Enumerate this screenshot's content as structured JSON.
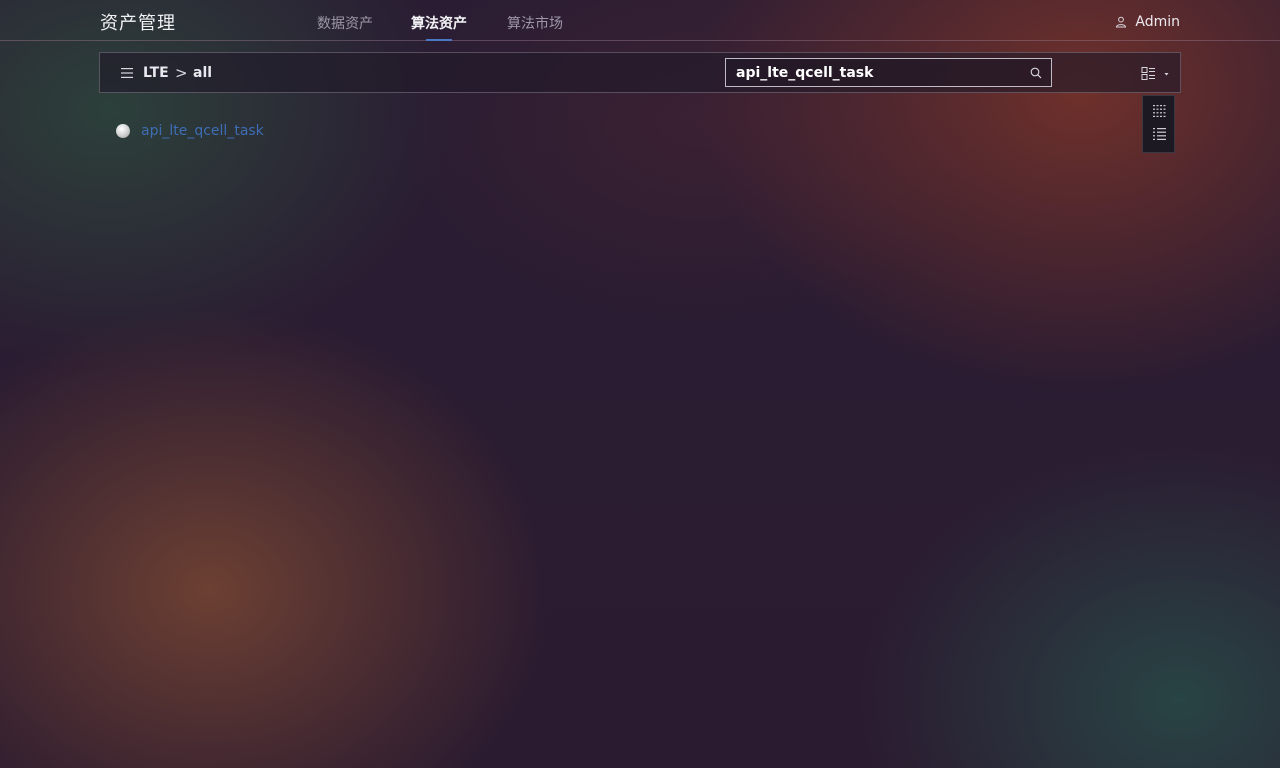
{
  "header": {
    "app_title": "资产管理",
    "tabs": [
      {
        "label": "数据资产",
        "active": false
      },
      {
        "label": "算法资产",
        "active": true
      },
      {
        "label": "算法市场",
        "active": false
      }
    ],
    "user": {
      "icon": "user-icon",
      "name": "Admin"
    }
  },
  "toolbar": {
    "menu_icon": "hamburger-menu-icon",
    "breadcrumb": {
      "root": "LTE",
      "separator": ">",
      "current": "all"
    },
    "search": {
      "value": "api_lte_qcell_task",
      "placeholder": "",
      "icon": "search-icon"
    },
    "view_toggle_icon": "view-mode-icon"
  },
  "view_menu": {
    "options": [
      {
        "icon": "grid-view-icon"
      },
      {
        "icon": "list-view-icon"
      }
    ]
  },
  "results": [
    {
      "name": "api_lte_qcell_task",
      "status_color": "#c8c8c8"
    }
  ],
  "colors": {
    "accent": "#4a78c4",
    "link": "#3e6db5"
  }
}
